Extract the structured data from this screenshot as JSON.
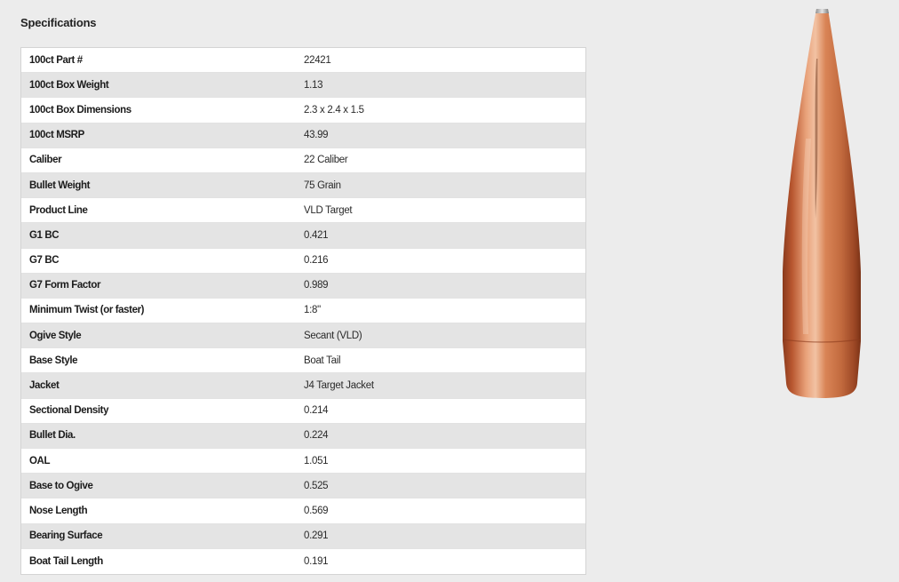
{
  "section_title": "Specifications",
  "specifications": [
    {
      "label": "100ct Part #",
      "value": "22421"
    },
    {
      "label": "100ct Box Weight",
      "value": "1.13"
    },
    {
      "label": "100ct Box Dimensions",
      "value": "2.3 x 2.4 x 1.5"
    },
    {
      "label": "100ct MSRP",
      "value": "43.99"
    },
    {
      "label": "Caliber",
      "value": "22 Caliber"
    },
    {
      "label": "Bullet Weight",
      "value": "75 Grain"
    },
    {
      "label": "Product Line",
      "value": "VLD Target"
    },
    {
      "label": "G1 BC",
      "value": "0.421"
    },
    {
      "label": "G7 BC",
      "value": "0.216"
    },
    {
      "label": "G7 Form Factor",
      "value": "0.989"
    },
    {
      "label": "Minimum Twist (or faster)",
      "value": "1:8\""
    },
    {
      "label": "Ogive Style",
      "value": "Secant (VLD)"
    },
    {
      "label": "Base Style",
      "value": "Boat Tail"
    },
    {
      "label": "Jacket",
      "value": "J4 Target Jacket"
    },
    {
      "label": "Sectional Density",
      "value": "0.214"
    },
    {
      "label": "Bullet Dia.",
      "value": "0.224"
    },
    {
      "label": "OAL",
      "value": "1.051"
    },
    {
      "label": "Base to Ogive",
      "value": "0.525"
    },
    {
      "label": "Nose Length",
      "value": "0.569"
    },
    {
      "label": "Bearing Surface",
      "value": "0.291"
    },
    {
      "label": "Boat Tail Length",
      "value": "0.191"
    }
  ],
  "colors": {
    "page_background": "#ececec",
    "row_white": "#ffffff",
    "row_gray": "#e4e4e4",
    "bullet_copper": "#c8683a"
  }
}
